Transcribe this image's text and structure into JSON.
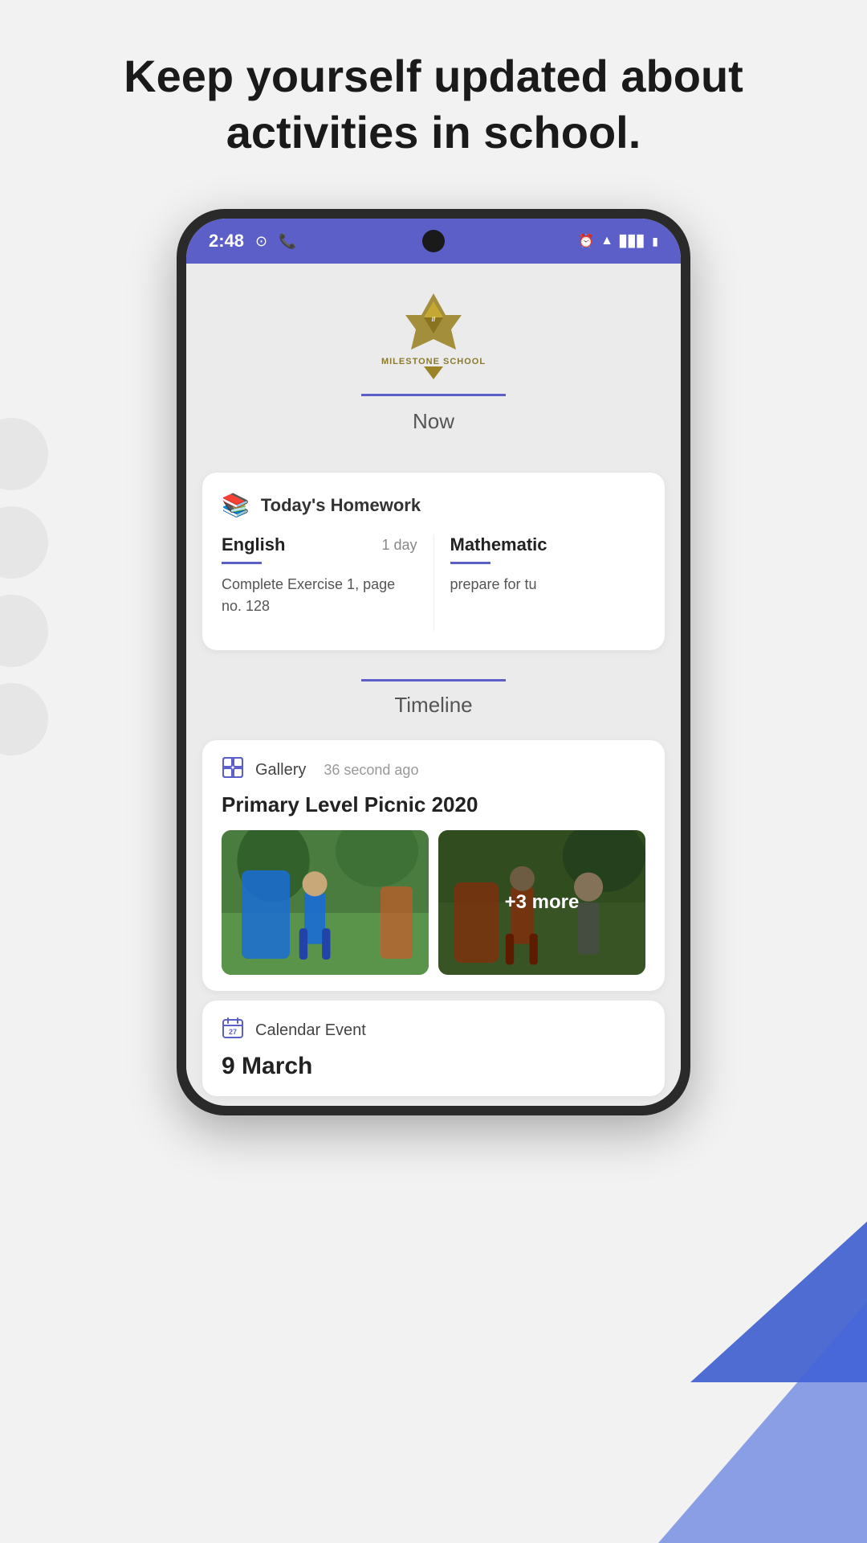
{
  "page": {
    "header": "Keep yourself updated about activities in school."
  },
  "statusBar": {
    "time": "2:48",
    "icons_left": [
      "spotify-icon",
      "whatsapp-icon"
    ],
    "icons_right": [
      "alarm-icon",
      "wifi-icon",
      "signal-icon",
      "battery-icon"
    ]
  },
  "appHeader": {
    "schoolName": "MILESTONE SCHOOL",
    "nowLabel": "Now"
  },
  "homework": {
    "sectionTitle": "Today's Homework",
    "items": [
      {
        "subject": "English",
        "due": "1 day",
        "description": "Complete Exercise 1, page no. 128"
      },
      {
        "subject": "Mathematic",
        "due": "",
        "description": "prepare for tu"
      }
    ]
  },
  "timeline": {
    "label": "Timeline",
    "posts": [
      {
        "type": "Gallery",
        "time": "36 second ago",
        "title": "Primary Level Picnic 2020",
        "imageCount": 2,
        "moreCount": "+3 more"
      },
      {
        "type": "Calendar Event",
        "date": "9 March"
      }
    ]
  },
  "icons": {
    "homework": "📚",
    "gallery": "🖼",
    "calendar": "📅"
  }
}
